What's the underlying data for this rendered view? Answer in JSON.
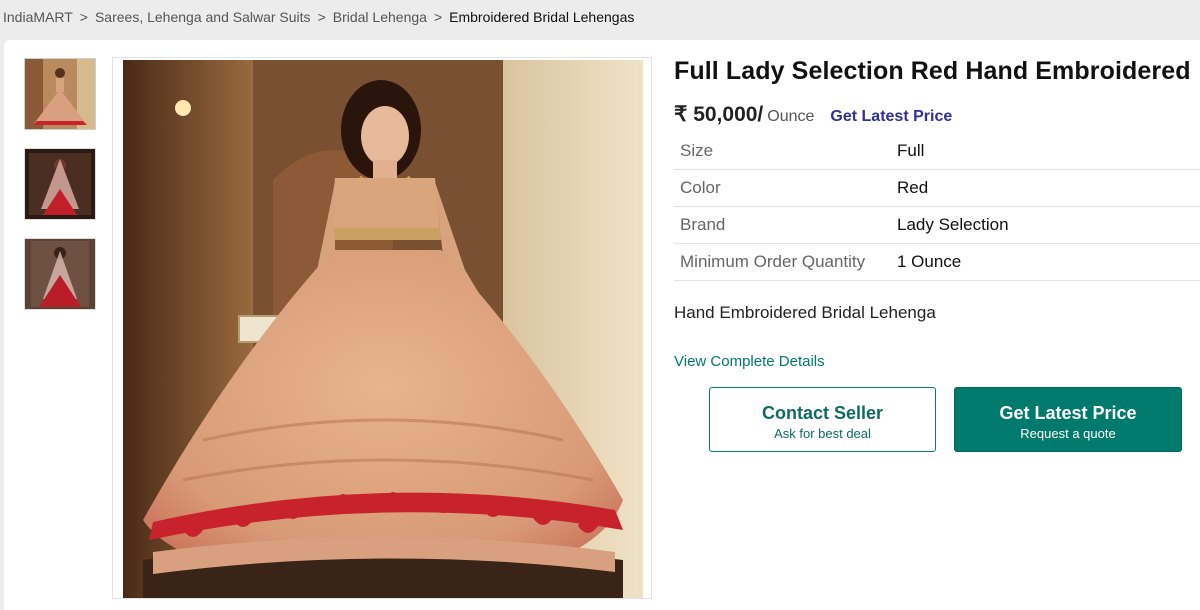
{
  "breadcrumb": [
    "IndiaMART",
    "Sarees, Lehenga and Salwar Suits",
    "Bridal Lehenga",
    "Embroidered Bridal Lehengas"
  ],
  "breadcrumb_separator": ">",
  "product": {
    "title": "Full Lady Selection Red Hand Embroidered",
    "price": "₹ 50,000/",
    "unit": "Ounce",
    "get_latest_price_link": "Get Latest Price",
    "specs": [
      {
        "label": "Size",
        "value": "Full"
      },
      {
        "label": "Color",
        "value": "Red"
      },
      {
        "label": "Brand",
        "value": "Lady Selection"
      },
      {
        "label": "Minimum Order Quantity",
        "value": "1 Ounce"
      }
    ],
    "description": "Hand Embroidered Bridal Lehenga",
    "view_details_link": "View Complete Details"
  },
  "buttons": {
    "contact_title": "Contact Seller",
    "contact_sub": "Ask for best deal",
    "latest_title": "Get Latest Price",
    "latest_sub": "Request a quote"
  },
  "colors": {
    "teal": "#007a6c",
    "link_blue": "#2e3192",
    "lehenga_red": "#c8232c",
    "gold": "#d9b07a"
  }
}
